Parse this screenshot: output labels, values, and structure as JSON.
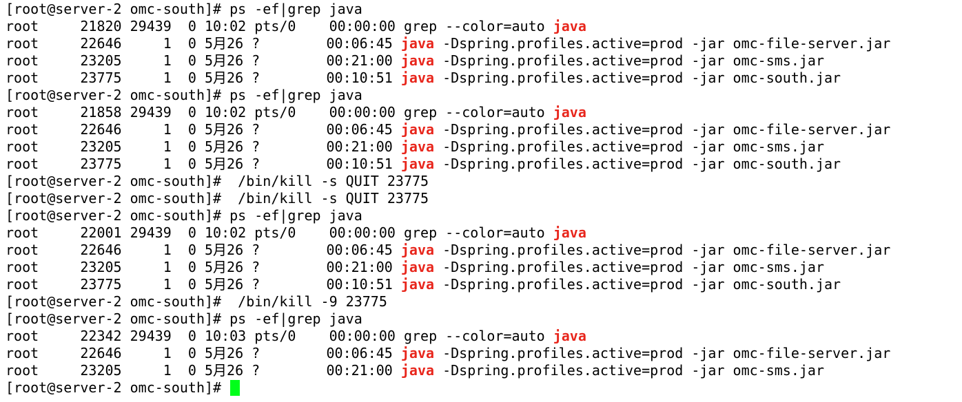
{
  "colors": {
    "background": "#ffffff",
    "text": "#000000",
    "highlight": "#e8261c",
    "cursor": "#00ff1a"
  },
  "prompt": "[root@server-2 omc-south]# ",
  "lines": [
    {
      "kind": "prompt",
      "text": "[root@server-2 omc-south]# ps -ef|grep java"
    },
    {
      "kind": "output",
      "pre": "root     21820 29439  0 10:02 pts/0    00:00:00 grep --color=auto ",
      "hl": "java",
      "post": ""
    },
    {
      "kind": "output",
      "pre": "root     22646     1  0 5月26 ?        00:06:45 ",
      "hl": "java",
      "post": " -Dspring.profiles.active=prod -jar omc-file-server.jar"
    },
    {
      "kind": "output",
      "pre": "root     23205     1  0 5月26 ?        00:21:00 ",
      "hl": "java",
      "post": " -Dspring.profiles.active=prod -jar omc-sms.jar"
    },
    {
      "kind": "output",
      "pre": "root     23775     1  0 5月26 ?        00:10:51 ",
      "hl": "java",
      "post": " -Dspring.profiles.active=prod -jar omc-south.jar"
    },
    {
      "kind": "prompt",
      "text": "[root@server-2 omc-south]# ps -ef|grep java"
    },
    {
      "kind": "output",
      "pre": "root     21858 29439  0 10:02 pts/0    00:00:00 grep --color=auto ",
      "hl": "java",
      "post": ""
    },
    {
      "kind": "output",
      "pre": "root     22646     1  0 5月26 ?        00:06:45 ",
      "hl": "java",
      "post": " -Dspring.profiles.active=prod -jar omc-file-server.jar"
    },
    {
      "kind": "output",
      "pre": "root     23205     1  0 5月26 ?        00:21:00 ",
      "hl": "java",
      "post": " -Dspring.profiles.active=prod -jar omc-sms.jar"
    },
    {
      "kind": "output",
      "pre": "root     23775     1  0 5月26 ?        00:10:51 ",
      "hl": "java",
      "post": " -Dspring.profiles.active=prod -jar omc-south.jar"
    },
    {
      "kind": "prompt",
      "text": "[root@server-2 omc-south]#  /bin/kill -s QUIT 23775"
    },
    {
      "kind": "prompt",
      "text": "[root@server-2 omc-south]#  /bin/kill -s QUIT 23775"
    },
    {
      "kind": "prompt",
      "text": "[root@server-2 omc-south]# ps -ef|grep java"
    },
    {
      "kind": "output",
      "pre": "root     22001 29439  0 10:02 pts/0    00:00:00 grep --color=auto ",
      "hl": "java",
      "post": ""
    },
    {
      "kind": "output",
      "pre": "root     22646     1  0 5月26 ?        00:06:45 ",
      "hl": "java",
      "post": " -Dspring.profiles.active=prod -jar omc-file-server.jar"
    },
    {
      "kind": "output",
      "pre": "root     23205     1  0 5月26 ?        00:21:00 ",
      "hl": "java",
      "post": " -Dspring.profiles.active=prod -jar omc-sms.jar"
    },
    {
      "kind": "output",
      "pre": "root     23775     1  0 5月26 ?        00:10:51 ",
      "hl": "java",
      "post": " -Dspring.profiles.active=prod -jar omc-south.jar"
    },
    {
      "kind": "prompt",
      "text": "[root@server-2 omc-south]#  /bin/kill -9 23775"
    },
    {
      "kind": "prompt",
      "text": "[root@server-2 omc-south]# ps -ef|grep java"
    },
    {
      "kind": "output",
      "pre": "root     22342 29439  0 10:03 pts/0    00:00:00 grep --color=auto ",
      "hl": "java",
      "post": ""
    },
    {
      "kind": "output",
      "pre": "root     22646     1  0 5月26 ?        00:06:45 ",
      "hl": "java",
      "post": " -Dspring.profiles.active=prod -jar omc-file-server.jar"
    },
    {
      "kind": "output",
      "pre": "root     23205     1  0 5月26 ?        00:21:00 ",
      "hl": "java",
      "post": " -Dspring.profiles.active=prod -jar omc-sms.jar"
    },
    {
      "kind": "cursor",
      "text": "[root@server-2 omc-south]# "
    }
  ]
}
